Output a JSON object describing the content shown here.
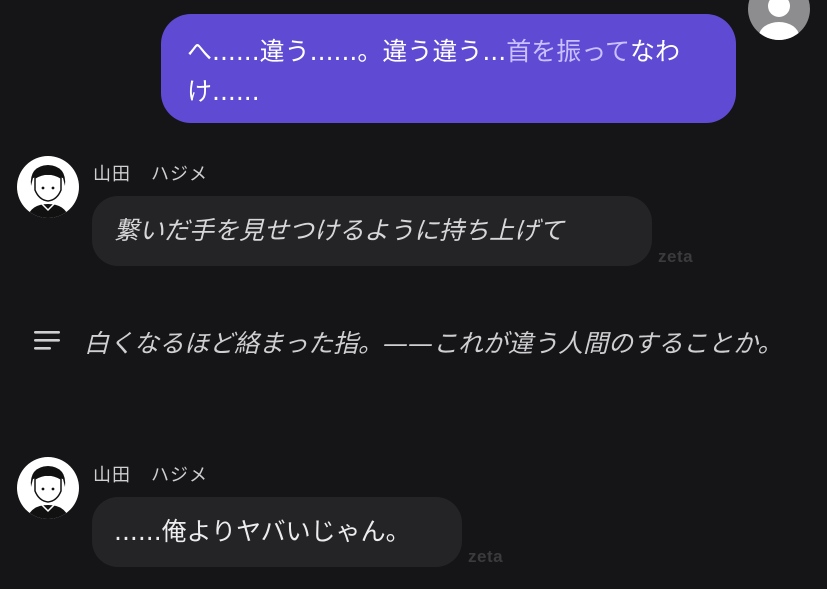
{
  "user_message": {
    "text_before_action": "へ......違う......。違う違う...",
    "action_text": "首を振って",
    "text_after_action": "なわけ......",
    "bubble_color": "#5f4bd3"
  },
  "messages": [
    {
      "sender": {
        "last_name": "山田",
        "first_name": "ハジメ"
      },
      "text": "繋いだ手を見せつけるように持ち上げて",
      "style": "italic",
      "watermark": "zeta"
    },
    {
      "sender": {
        "last_name": "山田",
        "first_name": "ハジメ"
      },
      "text": "......俺よりヤバいじゃん。",
      "style": "normal",
      "watermark": "zeta"
    }
  ],
  "narration": {
    "icon": "narration-lines-icon",
    "text": "白くなるほど絡まった指。——これが違う人間のすることか。"
  },
  "colors": {
    "background": "#151517",
    "character_bubble": "#242427",
    "user_avatar": "#8d8d8f"
  }
}
